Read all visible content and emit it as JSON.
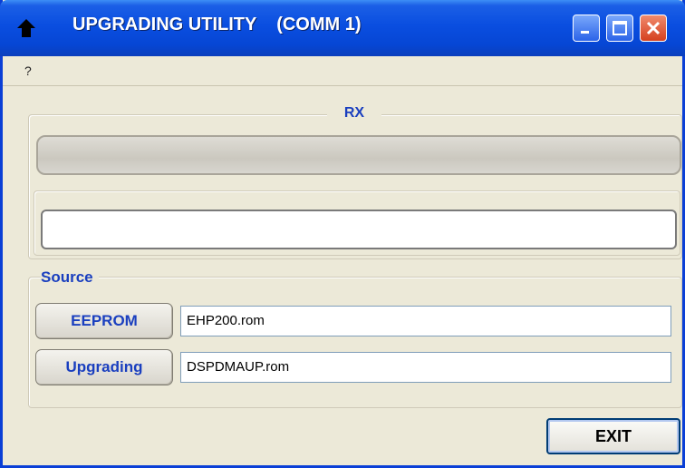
{
  "window": {
    "title": "UPGRADING UTILITY    (COMM 1)",
    "icon": "up-arrow-icon"
  },
  "menubar": {
    "items": [
      {
        "label": "?"
      }
    ]
  },
  "rx_group": {
    "label": "RX",
    "progress": 0,
    "status_text": ""
  },
  "source_group": {
    "label": "Source",
    "rows": [
      {
        "button_label": "EEPROM",
        "file": "EHP200.rom"
      },
      {
        "button_label": "Upgrading",
        "file": "DSPDMAUP.rom"
      }
    ]
  },
  "exit_button": {
    "label": "EXIT"
  },
  "colors": {
    "accent_text": "#1a3fbf",
    "titlebar": "#0a4ee0",
    "close": "#d5401f"
  }
}
